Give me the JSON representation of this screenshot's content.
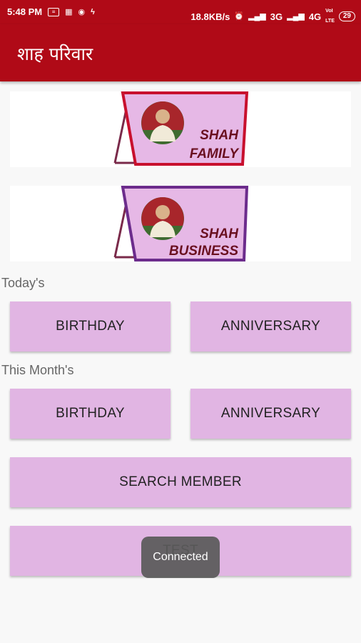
{
  "status_bar": {
    "time": "5:48 PM",
    "speed": "18.8KB/s",
    "net1": "3G",
    "net2": "4G",
    "volte": "VoI LTE",
    "battery": "29"
  },
  "app_bar": {
    "title": "शाह परिवार"
  },
  "banners": [
    {
      "line1": "SHAH",
      "line2": "FAMILY",
      "frame_color": "#c8102e"
    },
    {
      "line1": "SHAH",
      "line2": "BUSINESS",
      "frame_color": "#6c2c8c"
    }
  ],
  "today": {
    "label": "Today's",
    "birthday": "BIRTHDAY",
    "anniversary": "ANNIVERSARY"
  },
  "month": {
    "label": "This Month's",
    "birthday": "BIRTHDAY",
    "anniversary": "ANNIVERSARY"
  },
  "search_button": "SEARCH MEMBER",
  "test_button": "TEST",
  "toast": "Connected",
  "colors": {
    "primary": "#b00a17",
    "button": "#e1b5e3",
    "card": "#e6b8e6"
  }
}
